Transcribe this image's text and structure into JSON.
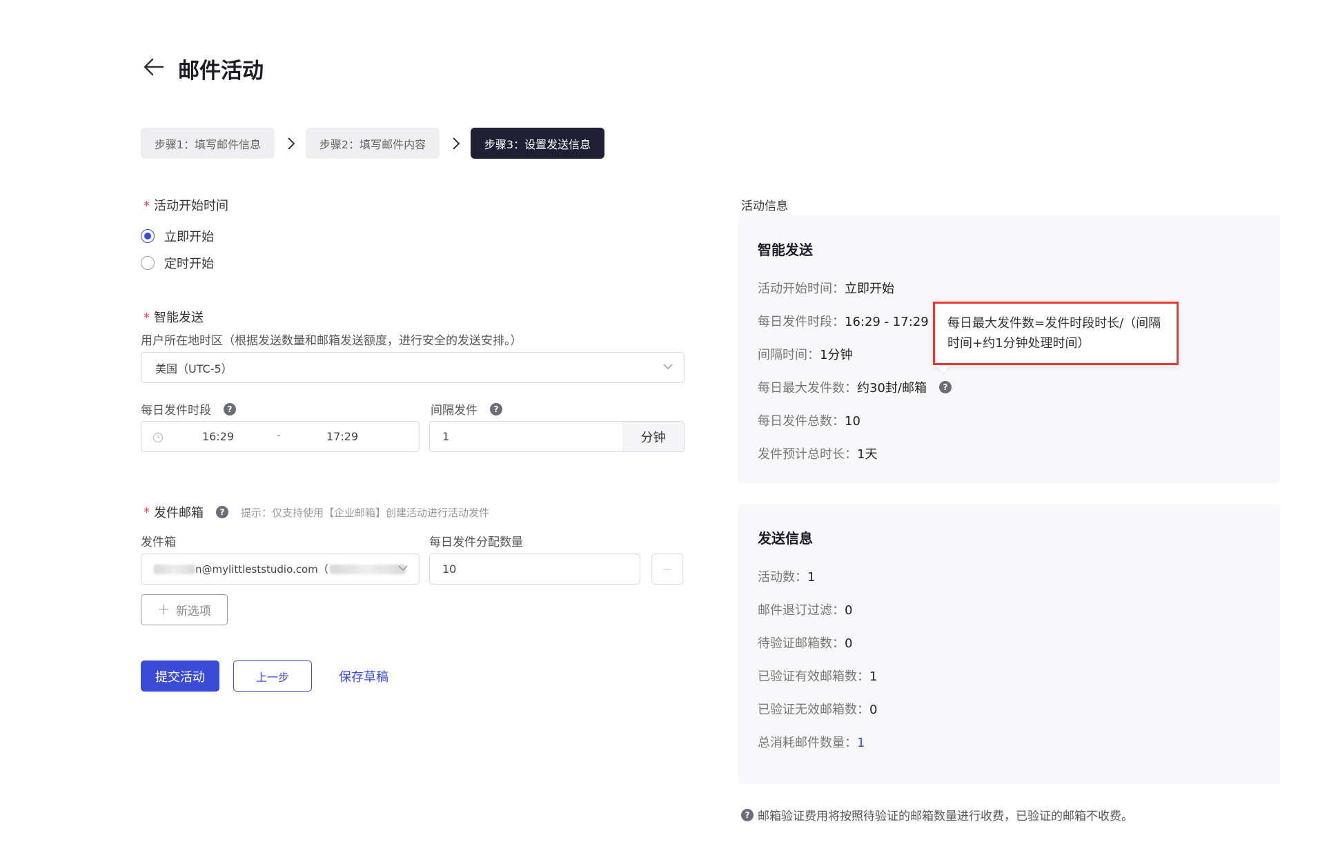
{
  "header": {
    "title": "邮件活动"
  },
  "steps": [
    {
      "label": "步骤1：填写邮件信息",
      "active": false
    },
    {
      "label": "步骤2：填写邮件内容",
      "active": false
    },
    {
      "label": "步骤3：设置发送信息",
      "active": true
    }
  ],
  "form": {
    "start_time": {
      "label": "活动开始时间",
      "options": [
        {
          "label": "立即开始",
          "selected": true
        },
        {
          "label": "定时开始",
          "selected": false
        }
      ]
    },
    "smart_send": {
      "label": "智能发送",
      "timezone_label": "用户所在地时区（根据发送数量和邮箱发送额度，进行安全的发送安排。）",
      "timezone_value": "美国（UTC-5）",
      "daily_period_label": "每日发件时段",
      "time_start": "16:29",
      "time_separator": "-",
      "time_end": "17:29",
      "interval_label": "间隔发件",
      "interval_value": "1",
      "interval_unit": "分钟"
    },
    "sender": {
      "label": "发件邮箱",
      "hint": "提示：仅支持使用【企业邮箱】创建活动进行活动发件",
      "outbox_label": "发件箱",
      "outbox_value_visible": "n@mylittleststudio.com（",
      "quota_label": "每日发件分配数量",
      "quota_value": "10",
      "remove_symbol": "—",
      "add_label": "新选项"
    },
    "actions": {
      "submit": "提交活动",
      "prev": "上一步",
      "save_draft": "保存草稿"
    }
  },
  "activity_info": {
    "section_label": "活动信息",
    "smart_panel": {
      "title": "智能发送",
      "rows": [
        {
          "key": "活动开始时间：",
          "value": "立即开始"
        },
        {
          "key": "每日发件时段：",
          "value": "16:29 - 17:29"
        },
        {
          "key": "间隔时间：",
          "value": "1分钟"
        },
        {
          "key": "每日最大发件数：",
          "value": "约30封/邮箱"
        },
        {
          "key": "每日发件总数：",
          "value": "10"
        },
        {
          "key": "发件预计总时长：",
          "value": "1天"
        }
      ]
    },
    "tooltip": "每日最大发件数=发件时段时长/（间隔时间+约1分钟处理时间）",
    "send_panel": {
      "title": "发送信息",
      "rows": [
        {
          "key": "活动数：",
          "value": "1"
        },
        {
          "key": "邮件退订过滤：",
          "value": "0"
        },
        {
          "key": "待验证邮箱数：",
          "value": "0"
        },
        {
          "key": "已验证有效邮箱数：",
          "value": "1"
        },
        {
          "key": "已验证无效邮箱数：",
          "value": "0"
        },
        {
          "key": "总消耗邮件数量：",
          "value": "1"
        }
      ]
    },
    "footnote": "邮箱验证费用将按照待验证的邮箱数量进行收费，已验证的邮箱不收费。"
  },
  "icons": {
    "help": "?",
    "plus": "+"
  },
  "colors": {
    "primary": "#3a4bd8",
    "required": "#e5484d",
    "active_step": "#1f2033",
    "tooltip_border": "#e53935"
  }
}
